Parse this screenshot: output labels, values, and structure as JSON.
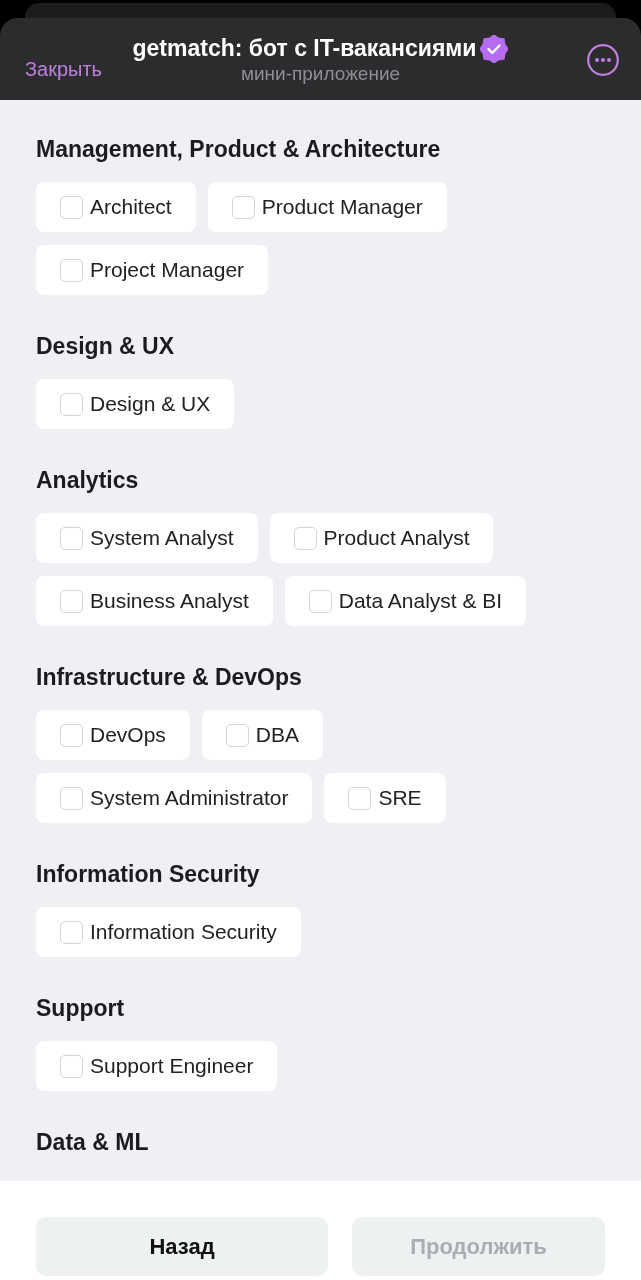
{
  "header": {
    "close_label": "Закрыть",
    "title": "getmatch: бот с IT-вакансиями",
    "verified": true,
    "subtitle": "мини-приложение"
  },
  "sections": [
    {
      "heading": "Management, Product & Architecture",
      "options": [
        {
          "label": "Architect",
          "checked": false
        },
        {
          "label": "Product Manager",
          "checked": false
        },
        {
          "label": "Project Manager",
          "checked": false
        }
      ]
    },
    {
      "heading": "Design & UX",
      "options": [
        {
          "label": "Design & UX",
          "checked": false
        }
      ]
    },
    {
      "heading": "Analytics",
      "options": [
        {
          "label": "System Analyst",
          "checked": false
        },
        {
          "label": "Product Analyst",
          "checked": false
        },
        {
          "label": "Business Analyst",
          "checked": false
        },
        {
          "label": "Data Analyst & BI",
          "checked": false
        }
      ]
    },
    {
      "heading": "Infrastructure & DevOps",
      "options": [
        {
          "label": "DevOps",
          "checked": false
        },
        {
          "label": "DBA",
          "checked": false
        },
        {
          "label": "System Administrator",
          "checked": false
        },
        {
          "label": "SRE",
          "checked": false
        }
      ]
    },
    {
      "heading": "Information Security",
      "options": [
        {
          "label": "Information Security",
          "checked": false
        }
      ]
    },
    {
      "heading": "Support",
      "options": [
        {
          "label": "Support Engineer",
          "checked": false
        }
      ]
    },
    {
      "heading": "Data & ML"
    }
  ],
  "footer": {
    "buttons": [
      {
        "label": "Назад",
        "disabled": false
      },
      {
        "label": "Продолжить",
        "disabled": true
      }
    ]
  }
}
